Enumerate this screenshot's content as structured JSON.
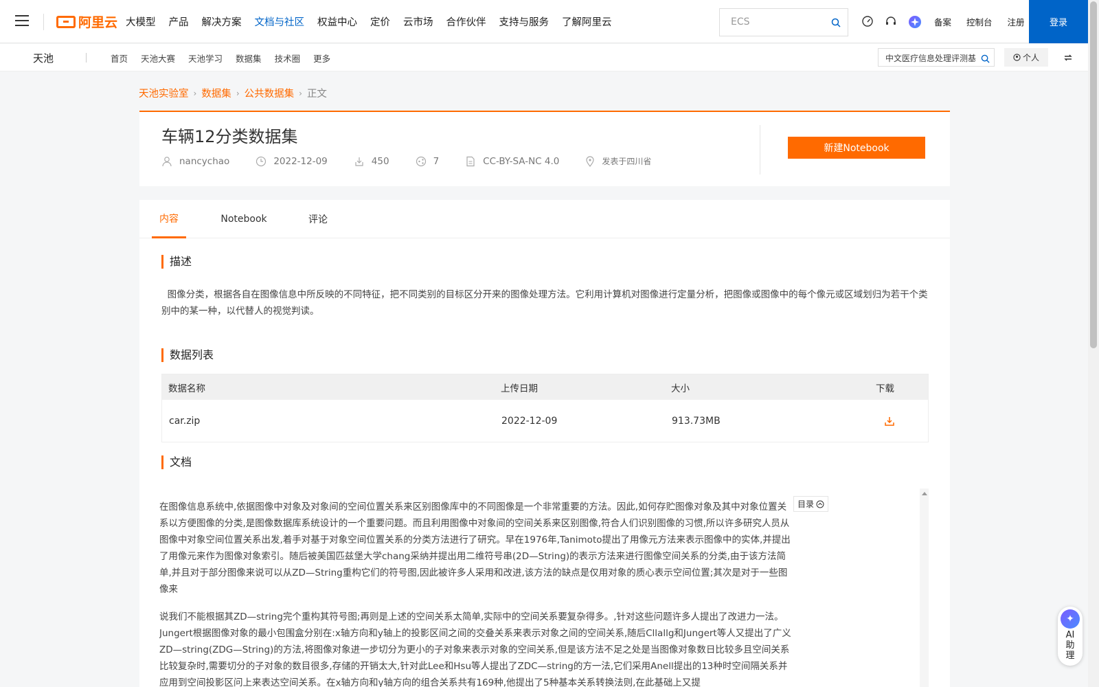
{
  "topnav": {
    "logo_text": "阿里云",
    "items": [
      "大模型",
      "产品",
      "解决方案",
      "文档与社区",
      "权益中心",
      "定价",
      "云市场",
      "合作伙伴",
      "支持与服务",
      "了解阿里云"
    ],
    "active_item": "文档与社区",
    "search_value": "ECS",
    "links": [
      "备案",
      "控制台",
      "注册"
    ],
    "login_label": "登录",
    "icons": [
      "speedometer-icon",
      "headset-icon",
      "ai-assistant-icon"
    ]
  },
  "subnav": {
    "brand": "天池",
    "items": [
      "首页",
      "天池大赛",
      "天池学习",
      "数据集",
      "技术圈",
      "更多"
    ],
    "search_value": "中文医疗信息处理评测基",
    "personal_label": "个人"
  },
  "breadcrumb": [
    "天池实验室",
    "数据集",
    "公共数据集",
    "正文"
  ],
  "dataset": {
    "title": "车辆12分类数据集",
    "author": "nancychao",
    "date": "2022-12-09",
    "downloads": "450",
    "shares": "7",
    "license": "CC-BY-SA-NC 4.0",
    "location": "发表于四川省",
    "new_notebook_label": "新建Notebook"
  },
  "tabs": [
    "内容",
    "Notebook",
    "评论"
  ],
  "active_tab": "内容",
  "sections": {
    "description_title": "描述",
    "description_text": "图像分类，根据各自在图像信息中所反映的不同特征，把不同类别的目标区分开来的图像处理方法。它利用计算机对图像进行定量分析，把图像或图像中的每个像元或区域划归为若干个类别中的某一种，以代替人的视觉判读。",
    "datalist_title": "数据列表",
    "doc_title": "文档"
  },
  "table": {
    "headers": [
      "数据名称",
      "上传日期",
      "大小",
      "下载"
    ],
    "rows": [
      {
        "name": "car.zip",
        "date": "2022-12-09",
        "size": "913.73MB"
      }
    ]
  },
  "doc": {
    "toc_label": "目录",
    "paragraphs": [
      "在图像信息系统中,依据图像中对象及对象间的空间位置关系来区别图像库中的不同图像是一个非常重要的方法。因此,如何存贮图像对象及其中对象位置关系以方便图像的分类,是图像数据库系统设计的一个重要问题。而且利用图像中对象间的空间关系来区别图像,符合人们识别图像的习惯,所以许多研究人员从图像中对象空间位置关系出发,着手对基于对象空间位置关系的分类方法进行了研究。早在1976年,Tanimoto提出了用像元方法来表示图像中的实体,并提出了用像元来作为图像对象索引。随后被美国匹兹堡大学chang采纳并提出用二维符号串(2D—String)的表示方法来进行图像空间关系的分类,由于该方法简单,并且对于部分图像来说可以从ZD—String重构它们的符号图,因此被许多人采用和改进,该方法的缺点是仅用对象的质心表示空间位置;其次是对于一些图像来",
      "说我们不能根据其ZD—string完个重构其符号图;再则是上述的空间关系太简单,实际中的空间关系要复杂得多。,针对这些问题许多人提出了改进力一法。Jungert根据图像对象的最小包围盒分别在:x轴方向和y轴上的投影区间之间的交叠关系来表示对象之间的空间关系,随后Cllallg和Jungert等人又提出了广义ZD—string(ZDG—String)的方法,将图像对象进一步切分为更小的子对象来表示对象的空间关系,但是该方法不足之处是当图像对象数日比较多且空间关系比较复杂时,需要切分的子对象的数目很多,存储的开销太大,针对此Lee和Hsu等人提出了ZDC—string的方一法,它们采用Anell提出的13种时空间隔关系并应用到空间投影区问上来表达空间关系。在x轴方向和y轴方向的组合关系共有169种,他提出了5种基本关系转换法则,在此基础上又提"
    ]
  },
  "ai_helper": {
    "label": "AI助理"
  },
  "colors": {
    "accent": "#ff6a00",
    "brand_blue": "#0064c8"
  }
}
